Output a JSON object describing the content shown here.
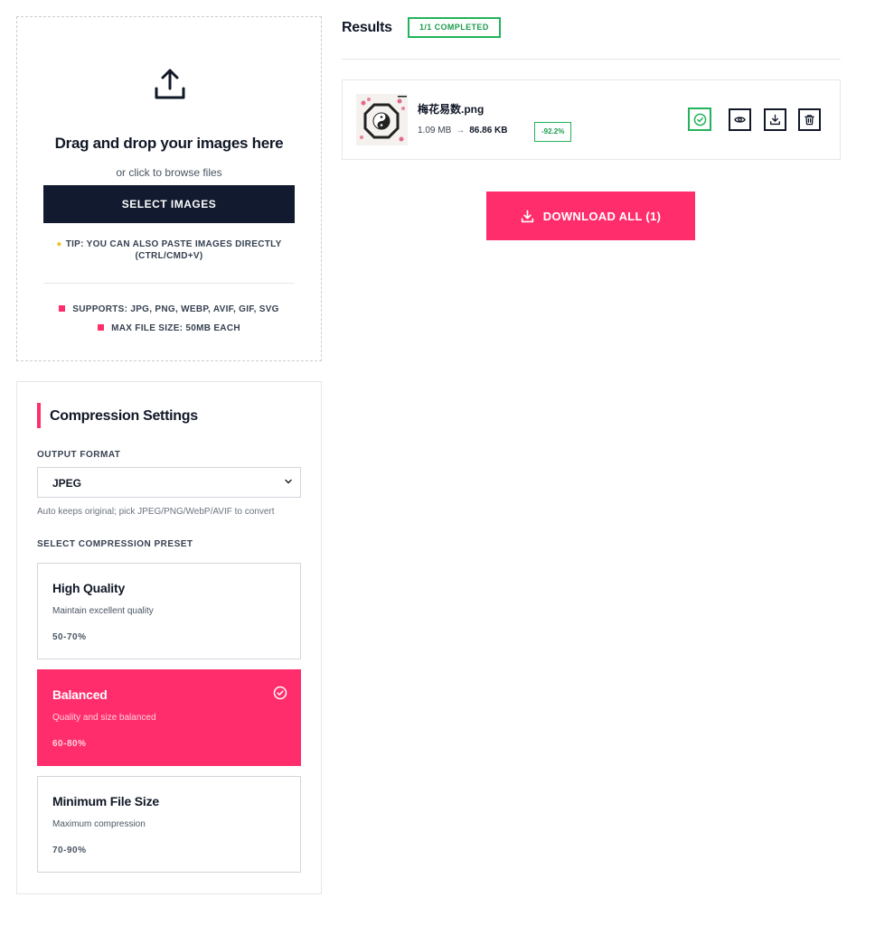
{
  "upload": {
    "icon": "upload-icon",
    "title": "Drag and drop your images here",
    "subtitle": "or click to browse files",
    "select_button": "SELECT IMAGES",
    "tip_icon": "lightbulb-icon",
    "tip": "TIP: YOU CAN ALSO PASTE IMAGES DIRECTLY (CTRL/CMD+V)",
    "supports": "SUPPORTS: JPG, PNG, WEBP, AVIF, GIF, SVG",
    "max_size": "MAX FILE SIZE: 50MB EACH"
  },
  "settings": {
    "heading": "Compression Settings",
    "output_format_label": "OUTPUT FORMAT",
    "output_format_value": "JPEG",
    "output_format_hint": "Auto keeps original; pick JPEG/PNG/WebP/AVIF to convert",
    "preset_label": "SELECT COMPRESSION PRESET",
    "presets": [
      {
        "name": "High Quality",
        "description": "Maintain excellent quality",
        "range": "50-70%",
        "selected": false
      },
      {
        "name": "Balanced",
        "description": "Quality and size balanced",
        "range": "60-80%",
        "selected": true
      },
      {
        "name": "Minimum File Size",
        "description": "Maximum compression",
        "range": "70-90%",
        "selected": false
      }
    ]
  },
  "results": {
    "title": "Results",
    "completed_badge": "1/1 COMPLETED",
    "files": [
      {
        "name": "梅花易数.png",
        "original_size": "1.09 MB",
        "arrow": "→",
        "compressed_size": "86.86 KB",
        "reduction": "-92.2%",
        "status_icon": "check-circle-icon",
        "actions": [
          "eye-icon",
          "download-icon",
          "trash-icon"
        ]
      }
    ],
    "download_all": "DOWNLOAD ALL (1)"
  },
  "colors": {
    "accent": "#ff2d6b",
    "dark": "#111a2e",
    "success": "#22b35a"
  }
}
